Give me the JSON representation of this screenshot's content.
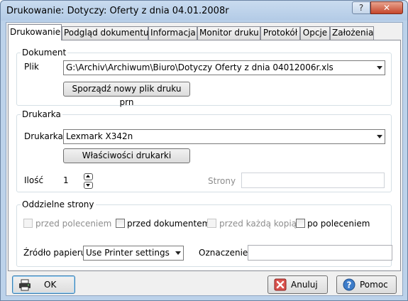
{
  "window": {
    "title": "Drukowanie: Dotyczy: Oferty z dnia 04.01.2008r",
    "help_glyph": "?",
    "close_glyph": "✕"
  },
  "tabs": [
    {
      "label": "Drukowanie"
    },
    {
      "label": "Podgląd dokumentu"
    },
    {
      "label": "Informacja"
    },
    {
      "label": "Monitor druku"
    },
    {
      "label": "Protokół"
    },
    {
      "label": "Opcje"
    },
    {
      "label": "Założenia"
    }
  ],
  "dokument": {
    "group_label": "Dokument",
    "plik_label": "Plik",
    "plik_value": "G:\\Archiv\\Archiwum\\Biuro\\Dotyczy Oferty z dnia 04012006r.xls",
    "new_file_button": "Sporządź nowy plik druku prn"
  },
  "drukarka": {
    "group_label": "Drukarka",
    "printer_label": "Drukarka",
    "printer_value": "Lexmark X342n",
    "properties_button": "Właściwości drukarki",
    "ilosc_label": "Ilość",
    "ilosc_value": "1",
    "strony_label": "Strony",
    "strony_value": ""
  },
  "oddzielne": {
    "group_label": "Oddzielne strony",
    "options": [
      {
        "label": "przed poleceniem",
        "enabled": false
      },
      {
        "label": "przed dokumentem",
        "enabled": true
      },
      {
        "label": "przed każdą kopią",
        "enabled": false
      },
      {
        "label": "po poleceniem",
        "enabled": true
      }
    ],
    "zrodlo_label": "Źródło papieru",
    "zrodlo_value": "Use Printer settings",
    "oznaczenie_label": "Oznaczenie",
    "oznaczenie_value": ""
  },
  "buttons": {
    "ok": "OK",
    "cancel": "Anuluj",
    "help": "Pomoc"
  },
  "colors": {
    "title_bg": "#bcd2ea",
    "close_button": "#c5462b",
    "default_button_border": "#3c7fb1"
  }
}
